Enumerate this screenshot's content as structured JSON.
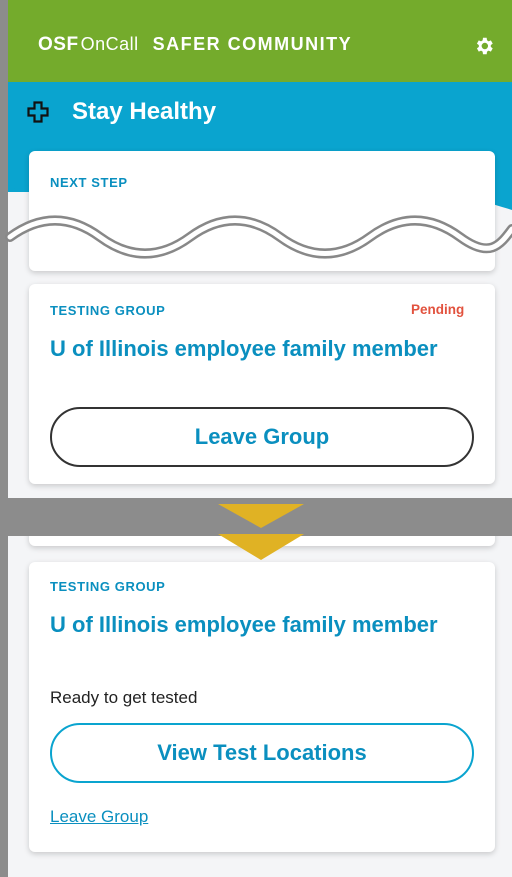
{
  "header": {
    "brand_osf": "OSF",
    "brand_oncall": "OnCall",
    "brand_product": "SAFER COMMUNITY",
    "settings_icon": "gear-icon"
  },
  "banner": {
    "icon": "plus-outline-icon",
    "title": "Stay Healthy"
  },
  "next_step": {
    "label": "NEXT STEP"
  },
  "before_card": {
    "label": "TESTING GROUP",
    "status": "Pending",
    "group_name": "U of Illinois employee family member",
    "leave_button": "Leave Group"
  },
  "after_card": {
    "label": "TESTING GROUP",
    "group_name": "U of Illinois employee family member",
    "ready_text": "Ready to get tested",
    "locations_button": "View Test Locations",
    "leave_link": "Leave Group"
  },
  "colors": {
    "header_green": "#74ab2c",
    "brand_blue": "#0aa4cf",
    "pending_red": "#e2523e",
    "arrow_gold": "#e0b224"
  }
}
